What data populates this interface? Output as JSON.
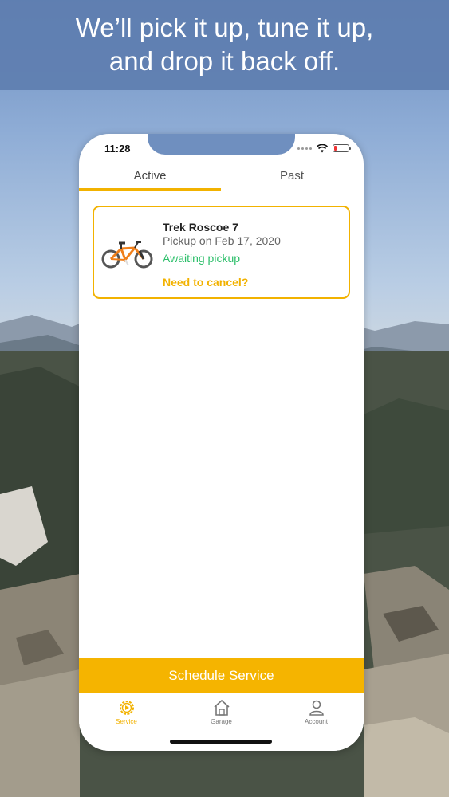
{
  "promo": {
    "headline": "We’ll pick it up, tune it up,\nand drop it back off."
  },
  "status_bar": {
    "time": "11:28",
    "icons": [
      "signal-dots-icon",
      "wifi-icon",
      "battery-icon"
    ]
  },
  "tabs": [
    {
      "label": "Active",
      "selected": true
    },
    {
      "label": "Past",
      "selected": false
    }
  ],
  "orders": [
    {
      "bike_name": "Trek Roscoe 7",
      "pickup": "Pickup on Feb 17, 2020",
      "status": "Awaiting pickup",
      "cancel_label": "Need to cancel?",
      "icon": "bike-icon"
    }
  ],
  "actions": {
    "schedule_label": "Schedule Service"
  },
  "tabbar": [
    {
      "label": "Service",
      "icon": "service-gear-icon",
      "active": true
    },
    {
      "label": "Garage",
      "icon": "garage-icon",
      "active": false
    },
    {
      "label": "Account",
      "icon": "account-icon",
      "active": false
    }
  ],
  "colors": {
    "accent": "#f5b400",
    "status_green": "#2cbf6a",
    "banner": "#5e7eb0"
  }
}
